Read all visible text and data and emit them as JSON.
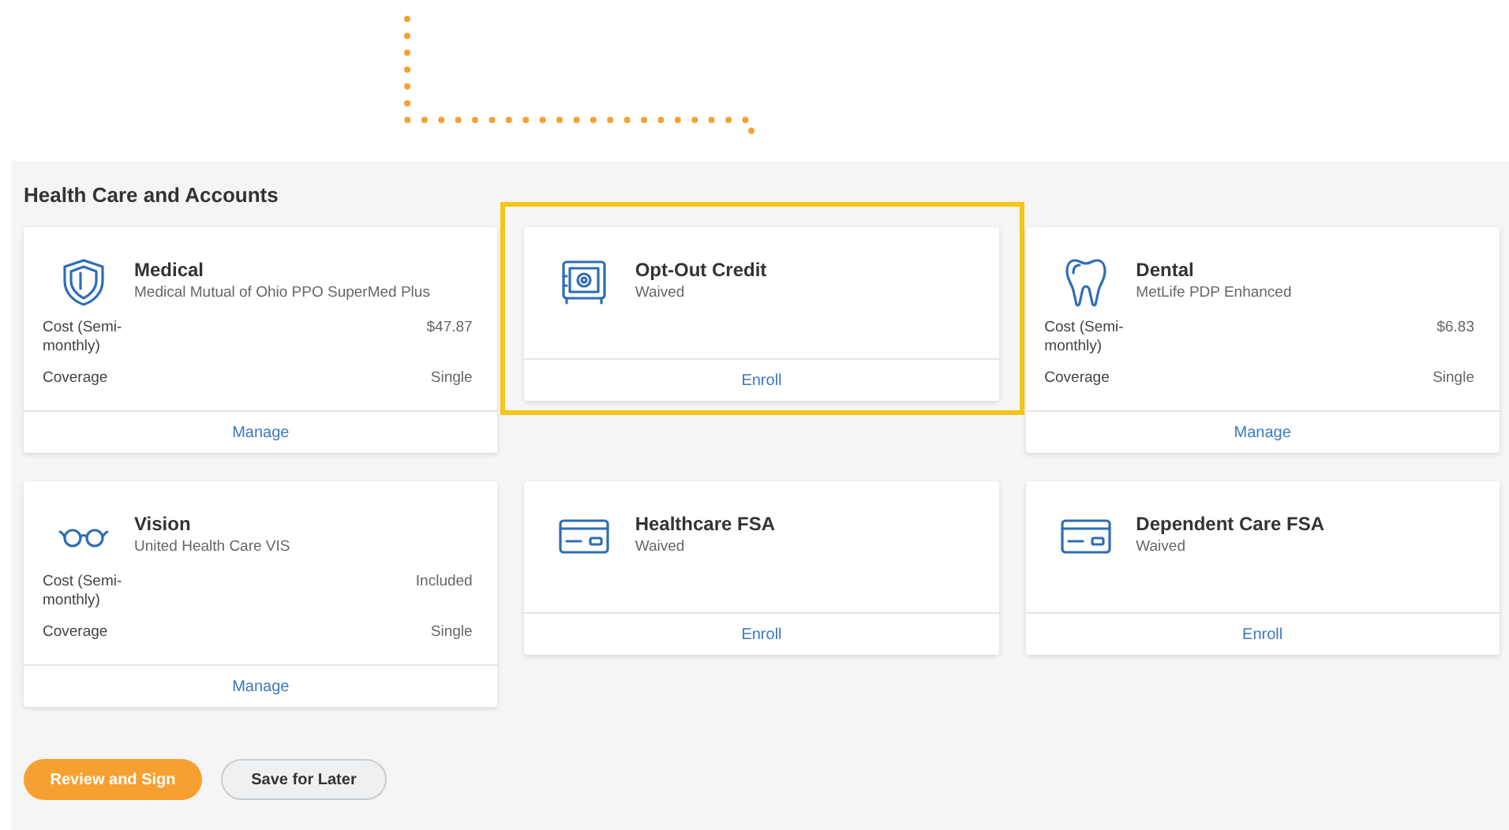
{
  "section_title": "Health Care and Accounts",
  "cards": [
    {
      "kind": "shield",
      "title": "Medical",
      "subtitle": "Medical Mutual of Ohio PPO SuperMed Plus",
      "highlighted": false,
      "details": [
        {
          "label": "Cost (Semi-monthly)",
          "value": "$47.87"
        },
        {
          "label": "Coverage",
          "value": "Single"
        }
      ],
      "action": "Manage"
    },
    {
      "kind": "safe",
      "title": "Opt-Out Credit",
      "subtitle": "Waived",
      "highlighted": true,
      "action": "Enroll"
    },
    {
      "kind": "tooth",
      "title": "Dental",
      "subtitle": "MetLife PDP Enhanced",
      "highlighted": false,
      "details": [
        {
          "label": "Cost (Semi-monthly)",
          "value": "$6.83"
        },
        {
          "label": "Coverage",
          "value": "Single"
        }
      ],
      "action": "Manage"
    },
    {
      "kind": "glasses",
      "title": "Vision",
      "subtitle": "United Health Care VIS",
      "highlighted": false,
      "details": [
        {
          "label": "Cost (Semi-monthly)",
          "value": "Included"
        },
        {
          "label": "Coverage",
          "value": "Single"
        }
      ],
      "action": "Manage"
    },
    {
      "kind": "card",
      "title": "Healthcare FSA",
      "subtitle": "Waived",
      "highlighted": false,
      "action": "Enroll"
    },
    {
      "kind": "card",
      "title": "Dependent Care FSA",
      "subtitle": "Waived",
      "highlighted": false,
      "action": "Enroll"
    }
  ],
  "buttons": [
    {
      "label": "Review and Sign",
      "kind": "primary"
    },
    {
      "label": "Save for Later",
      "kind": "secondary"
    }
  ]
}
